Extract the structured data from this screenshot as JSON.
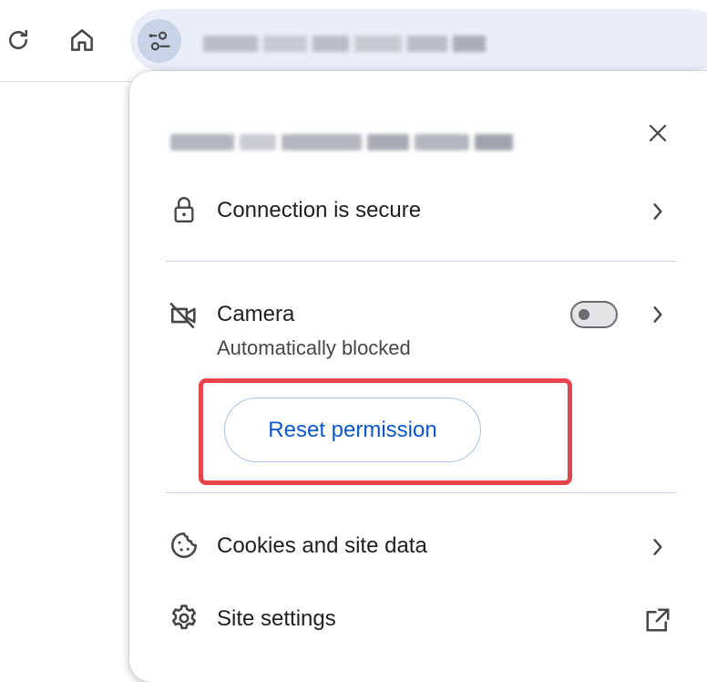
{
  "colors": {
    "accent": "#0b57d0",
    "highlight": "#e6454b",
    "omnibox_bg": "#e9eef8",
    "divider": "#c9d4ee"
  },
  "toolbar": {
    "reload_icon": "reload-icon",
    "home_icon": "home-icon",
    "site_info_icon": "tune-icon"
  },
  "popup": {
    "close_icon": "close-icon",
    "connection": {
      "icon": "lock-icon",
      "label": "Connection is secure"
    },
    "camera": {
      "icon": "camera-off-icon",
      "label": "Camera",
      "status": "Automatically blocked",
      "toggle_state": "off"
    },
    "reset_button_label": "Reset permission",
    "cookies": {
      "icon": "cookie-icon",
      "label": "Cookies and site data"
    },
    "site_settings": {
      "icon": "gear-icon",
      "label": "Site settings",
      "trailing_icon": "open-external-icon"
    }
  }
}
